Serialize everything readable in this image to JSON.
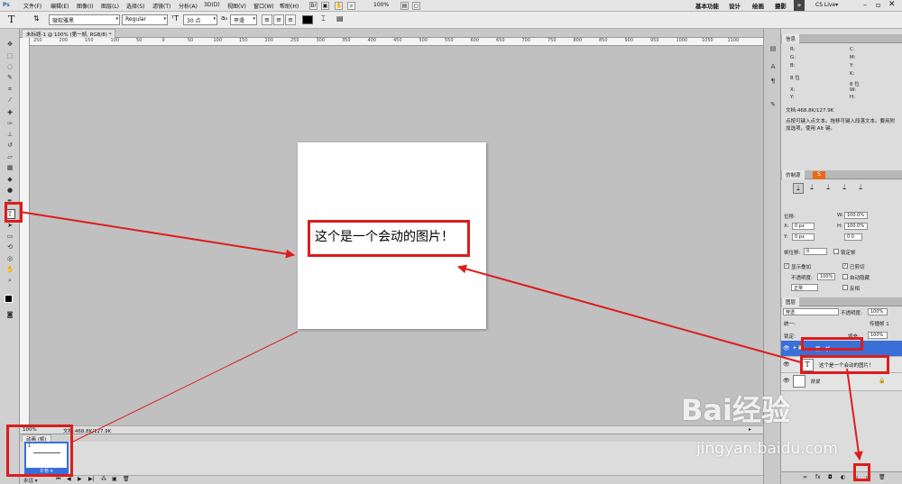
{
  "app": {
    "logo": "Ps"
  },
  "menus": [
    "文件(F)",
    "编辑(E)",
    "图像(I)",
    "图层(L)",
    "选择(S)",
    "滤镜(T)",
    "分析(A)",
    "3D(D)",
    "视图(V)",
    "窗口(W)",
    "帮助(H)"
  ],
  "menubar": {
    "zoom": "100%",
    "workspaces": [
      "基本功能",
      "设计",
      "绘画",
      "摄影"
    ],
    "more": "»",
    "cslive": "CS Live▾"
  },
  "options": {
    "font_family": "微软雅黑",
    "font_style": "Regular",
    "font_size": "30 点",
    "aa": "平滑",
    "color": "#000000"
  },
  "document": {
    "tab": "未标题-1 @ 100% (第一帧, RGB/8) *",
    "ruler_marks": [
      "250",
      "200",
      "150",
      "100",
      "50",
      "0",
      "50",
      "100",
      "150",
      "200",
      "250",
      "300",
      "350",
      "400",
      "450",
      "500",
      "550",
      "600",
      "650",
      "700",
      "750",
      "800",
      "850",
      "900",
      "950",
      "1000",
      "1050",
      "1100"
    ],
    "canvas_text": "这个是一个会动的图片！",
    "status_zoom": "100%",
    "status_doc": "文档:468.8K/127.9K"
  },
  "animation": {
    "tab": "动画 (帧)",
    "frame_number": "1",
    "frame_time": "0 秒 ▾",
    "loop": "永远 ▾"
  },
  "info": {
    "tab": "信息",
    "r": "R:",
    "g": "G:",
    "b": "B:",
    "c": "C:",
    "mm": "M:",
    "y": "Y:",
    "k": "K:",
    "bits1": "8 位",
    "bits2": "8 位",
    "x": "X:",
    "yy": "Y:",
    "w": "W:",
    "h": "H:",
    "doc": "文档:468.8K/127.9K",
    "hint": "点按可键入点文本。拖移可键入段落文本。要用附加选项，使用 Alt 键。"
  },
  "transform": {
    "tab": "仿制源",
    "offset": "位移:",
    "x": "X:",
    "x_val": "0 px",
    "y": "Y:",
    "y_val": "0 px",
    "w": "W:",
    "w_val": "100.0%",
    "h": "H:",
    "h_val": "100.0%",
    "angle_val": "0.0",
    "frame_offset": "帧位移:",
    "frame_offset_val": "0",
    "lock_frame": "锁定帧",
    "show_overlay": "显示叠加",
    "clipped": "已剪切",
    "opacity": "不透明度:",
    "opacity_val": "100%",
    "auto_hide": "自动隐藏",
    "mode": "正常",
    "invert": "反相"
  },
  "layers": {
    "tab": "图层",
    "blend": "穿透",
    "opacity_label": "不透明度:",
    "opacity_val": "100%",
    "unify": "统一:",
    "propagate": "传播帧 1",
    "lock": "锁定:",
    "fill_label": "填充:",
    "fill_val": "100%",
    "items": [
      {
        "name": "第一帧",
        "icon": "▸ 📁"
      },
      {
        "name": "这个是一个会动的图片！",
        "icon": "T"
      },
      {
        "name": "背景",
        "icon": ""
      }
    ]
  },
  "watermark": {
    "logo": "Bai经验",
    "url": "jingyan.baidu.com"
  },
  "colors": {
    "highlight": "#3a6fd8",
    "annotation": "#dd1c1c"
  }
}
